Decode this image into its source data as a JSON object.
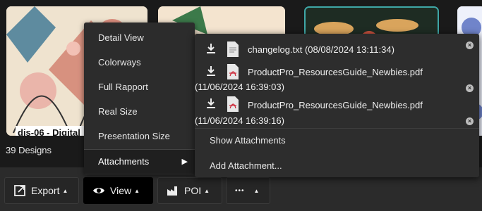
{
  "gallery": {
    "thumb1_caption": "dis-06 - Digital",
    "design_count": "39 Designs"
  },
  "toolbar": {
    "export_label": "Export",
    "view_label": "View",
    "poi_label": "POI",
    "more_label": "•••"
  },
  "view_menu": {
    "items": [
      "Detail View",
      "Colorways",
      "Full Rapport",
      "Real Size",
      "Presentation Size",
      "Attachments"
    ]
  },
  "attachments": {
    "files": [
      {
        "name": "changelog.txt (08/08/2024 13:11:34)",
        "type": "txt"
      },
      {
        "name": "ProductPro_ResourcesGuide_Newbies.pdf",
        "date": "(11/06/2024 16:39:03)",
        "type": "pdf"
      },
      {
        "name": "ProductPro_ResourcesGuide_Newbies.pdf",
        "date": "(11/06/2024 16:39:16)",
        "type": "pdf"
      }
    ],
    "show_label": "Show Attachments",
    "add_label": "Add Attachment..."
  },
  "colors": {
    "selected_thumb_border": "#3fa7a7",
    "menu_bg": "#2c2c2c",
    "toolbar_bg": "#2b2b2b",
    "active_button_bg": "#000000"
  }
}
